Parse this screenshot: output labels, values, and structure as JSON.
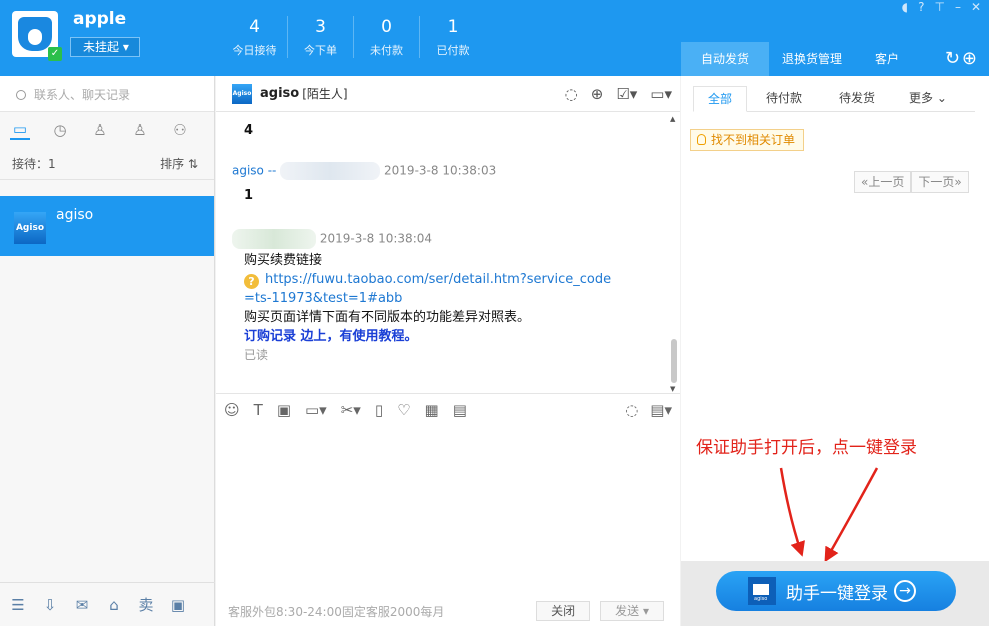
{
  "user": {
    "name": "apple",
    "status": "未挂起"
  },
  "stats": [
    {
      "value": "4",
      "label": "今日接待"
    },
    {
      "value": "3",
      "label": "今下单"
    },
    {
      "value": "0",
      "label": "未付款"
    },
    {
      "value": "1",
      "label": "已付款"
    }
  ],
  "right_tabs": [
    "自动发货",
    "退换货管理",
    "客户"
  ],
  "search": {
    "placeholder": "联系人、聊天记录"
  },
  "queue": {
    "count_label": "接待：1",
    "sort_label": "排序"
  },
  "contact": {
    "name": "agiso",
    "logo_text": "Agiso"
  },
  "chat": {
    "title": "agiso",
    "tag": "[陌生人]",
    "messages": [
      {
        "text": "4"
      },
      {
        "sender": "agiso --",
        "time": "2019-3-8 10:38:03",
        "text": "1"
      }
    ],
    "reply": {
      "time": "2019-3-8 10:38:04",
      "line1": "购买续费链接",
      "link1": "https://fuwu.taobao.com/ser/detail.htm?service_code",
      "link2": "=ts-11973&test=1#abb",
      "line2": "购买页面详情下面有不同版本的功能差异对照表。",
      "line3": "订购记录 边上，有使用教程。",
      "read": "已读"
    },
    "footer": {
      "hint": "客服外包8:30-24:00固定客服2000每月",
      "close": "关闭",
      "send": "发送"
    }
  },
  "orders": {
    "tabs": [
      "全部",
      "待付款",
      "待发货",
      "更多"
    ],
    "not_found": "找不到相关订单",
    "prev": "«上一页",
    "next": "下一页»"
  },
  "annotation": "保证助手打开后，点一键登录",
  "login_button": "助手一键登录",
  "colors": {
    "accent": "#1e98f0",
    "annotation": "#e2231a"
  }
}
